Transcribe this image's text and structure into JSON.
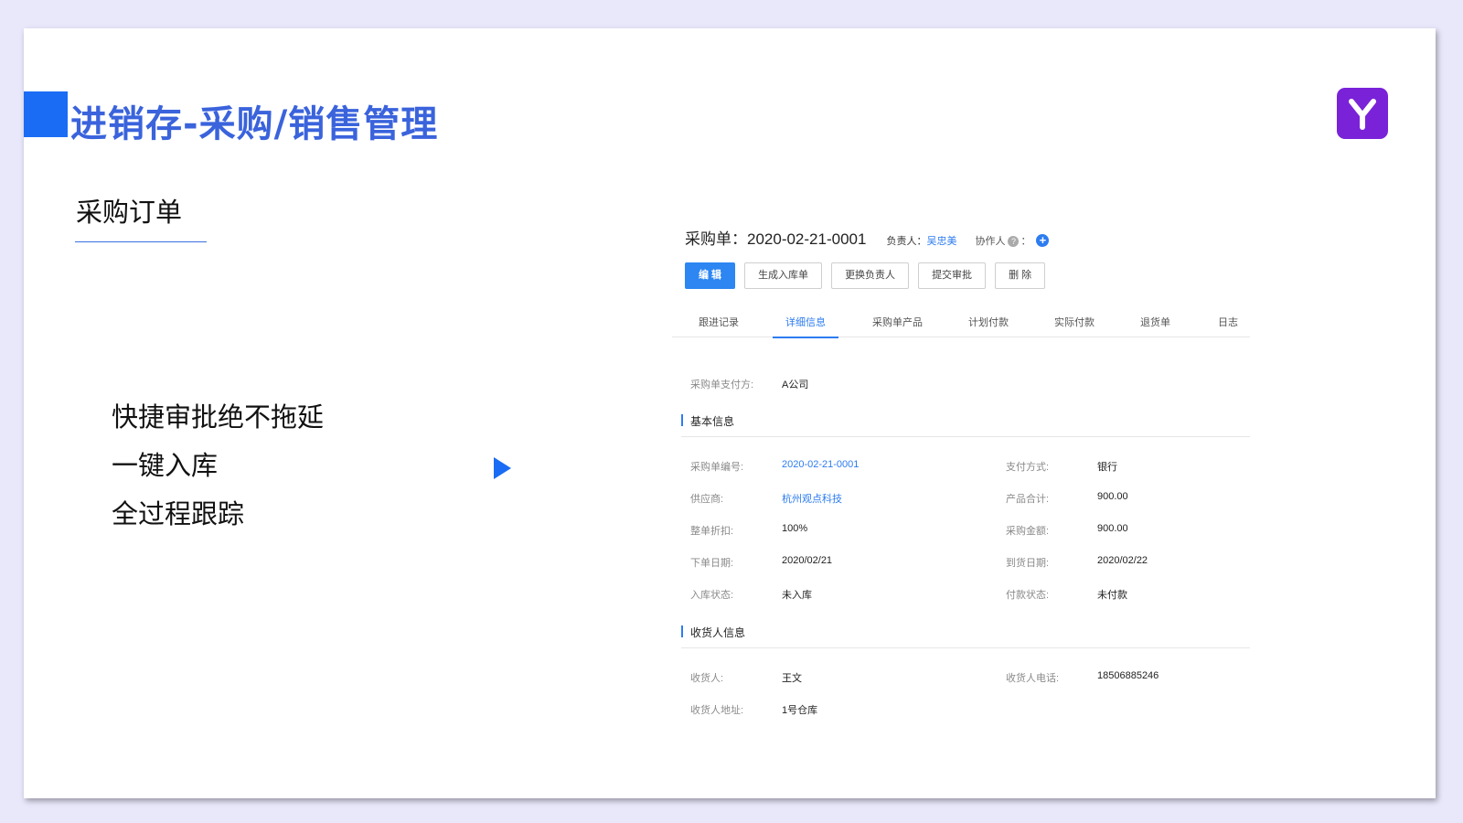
{
  "slide": {
    "title": "进销存-采购/销售管理",
    "section_title": "采购订单",
    "features": [
      "快捷审批绝不拖延",
      "一键入库",
      "全过程跟踪"
    ],
    "accent_color": "#1a6cf5",
    "logo_color": "#7a22d8"
  },
  "order": {
    "title": "采购单：2020-02-21-0001",
    "owner_label": "负责人：",
    "owner_name": "吴忠美",
    "collaborator_label": "协作人",
    "help_icon": "?",
    "colon": "：",
    "add_icon": "+"
  },
  "actions": {
    "edit": "编 辑",
    "generate_inbound": "生成入库单",
    "change_owner": "更换负责人",
    "submit_approval": "提交审批",
    "delete": "删 除"
  },
  "tabs": [
    {
      "label": "跟进记录"
    },
    {
      "label": "详细信息",
      "active": true
    },
    {
      "label": "采购单产品"
    },
    {
      "label": "计划付款"
    },
    {
      "label": "实际付款"
    },
    {
      "label": "退货单"
    },
    {
      "label": "日志"
    }
  ],
  "payer": {
    "label": "采购单支付方:",
    "value": "A公司"
  },
  "basic_info": {
    "heading": "基本信息",
    "fields": {
      "order_no": {
        "label": "采购单编号:",
        "value": "2020-02-21-0001"
      },
      "payment_method": {
        "label": "支付方式:",
        "value": "银行"
      },
      "supplier": {
        "label": "供应商:",
        "value": "杭州观点科技"
      },
      "product_total": {
        "label": "产品合计:",
        "value": "900.00"
      },
      "discount": {
        "label": "整单折扣:",
        "value": "100%"
      },
      "purchase_amount": {
        "label": "采购金额:",
        "value": "900.00"
      },
      "order_date": {
        "label": "下单日期:",
        "value": "2020/02/21"
      },
      "arrival_date": {
        "label": "到货日期:",
        "value": "2020/02/22"
      },
      "inbound_status": {
        "label": "入库状态:",
        "value": "未入库"
      },
      "payment_status": {
        "label": "付款状态:",
        "value": "未付款"
      }
    }
  },
  "receiver_info": {
    "heading": "收货人信息",
    "fields": {
      "receiver": {
        "label": "收货人:",
        "value": "王文"
      },
      "receiver_phone": {
        "label": "收货人电话:",
        "value": "18506885246"
      },
      "receiver_address": {
        "label": "收货人地址:",
        "value": "1号仓库"
      }
    }
  }
}
